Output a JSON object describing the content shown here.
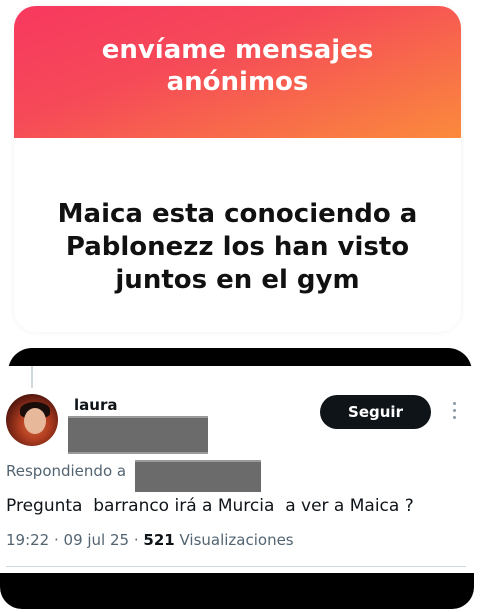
{
  "ngl_card": {
    "title_line1": "envíame mensajes",
    "title_line2": "anónimos",
    "message_line1": "Maica esta conociendo a",
    "message_line2": "Pablonezz los han visto",
    "message_line3": "juntos en el gym",
    "gradient_colors": [
      "#f7385f",
      "#fb8a3c"
    ]
  },
  "tweet": {
    "display_name": "laura",
    "follow_label": "Seguir",
    "reply_prefix": "Respondiendo a",
    "text": "Pregunta  barranco irá a Murcia  a ver a Maica ?",
    "time_date": "19:22 · 09 jul 25 · ",
    "views_count": "521",
    "views_label": " Visualizaciones",
    "avatar_icon": "profile-photo",
    "more_icon": "more-vertical-icon"
  }
}
